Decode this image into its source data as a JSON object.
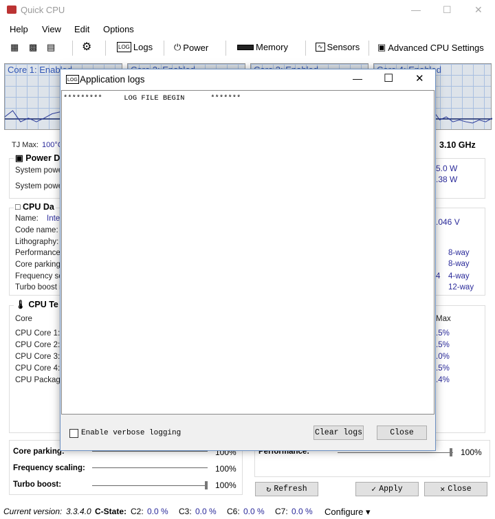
{
  "window": {
    "title": "Quick CPU"
  },
  "menu": [
    "Help",
    "View",
    "Edit",
    "Options"
  ],
  "toolbar": {
    "logs": "Logs",
    "power": "Power",
    "memory": "Memory",
    "sensors": "Sensors",
    "advanced": "Advanced CPU Settings"
  },
  "cores": [
    {
      "label": "Core 1: Enabled",
      "history": [
        20,
        30,
        12,
        18,
        12,
        18,
        25,
        28,
        20,
        25,
        20,
        28,
        75,
        25,
        20,
        10
      ]
    },
    {
      "label": "Core 2: Enabled",
      "history": []
    },
    {
      "label": "Core 3: Enabled",
      "history": []
    },
    {
      "label": "Core 4: Enabled",
      "history": [
        10,
        12,
        10,
        12,
        20,
        30,
        15,
        18,
        12,
        30,
        15,
        20,
        12,
        15,
        12,
        10,
        15,
        12,
        18
      ]
    }
  ],
  "info": {
    "tj_max_label": "TJ Max:",
    "tj_max_value": "100°C",
    "frequency": "3.10 GHz"
  },
  "power": {
    "title": "Power D",
    "rows": [
      "System power",
      "System power"
    ],
    "values": [
      "5.0 W",
      ".38 W"
    ]
  },
  "cpu_data": {
    "title": "CPU Da",
    "name_label": "Name:",
    "name_value": "Inte",
    "rows": [
      "Code name:",
      "Lithography:",
      "Performance",
      "Core parking i",
      "Frequency sc",
      "Turbo boost i"
    ],
    "voltage": ".046 V",
    "ways": [
      "8-way",
      "8-way",
      "4-way",
      "12-way"
    ],
    "extra": "4"
  },
  "temps": {
    "title": "CPU Te",
    "header": "Core",
    "max_header": "Max",
    "rows": [
      "CPU Core 1:",
      "CPU Core 2:",
      "CPU Core 3:",
      "CPU Core 4:",
      "CPU Package"
    ],
    "values": [
      ".5%",
      ".5%",
      ".0%",
      ".5%",
      ".4%"
    ]
  },
  "dialog": {
    "title": "Application logs",
    "log_text": "*********     LOG FILE BEGIN      *******",
    "verbose_label": "Enable verbose logging",
    "verbose_checked": false,
    "clear_label": "Clear logs",
    "close_label": "Close"
  },
  "sliders": {
    "core_parking": {
      "label": "Core parking:",
      "value": "100%"
    },
    "frequency_scaling": {
      "label": "Frequency scaling:",
      "value": "100%"
    },
    "turbo_boost": {
      "label": "Turbo boost:",
      "value": "100%"
    },
    "performance": {
      "label": "Performance:",
      "value": "100%"
    }
  },
  "buttons": {
    "refresh": "Refresh",
    "apply": "Apply",
    "close": "Close"
  },
  "status": {
    "version_label": "Current version:",
    "version": "3.3.4.0",
    "cstate_label": "C-State:",
    "c2_label": "C2:",
    "c2": "0.0 %",
    "c3_label": "C3:",
    "c3": "0.0 %",
    "c6_label": "C6:",
    "c6": "0.0 %",
    "c7_label": "C7:",
    "c7": "0.0 %",
    "configure": "Configure"
  }
}
